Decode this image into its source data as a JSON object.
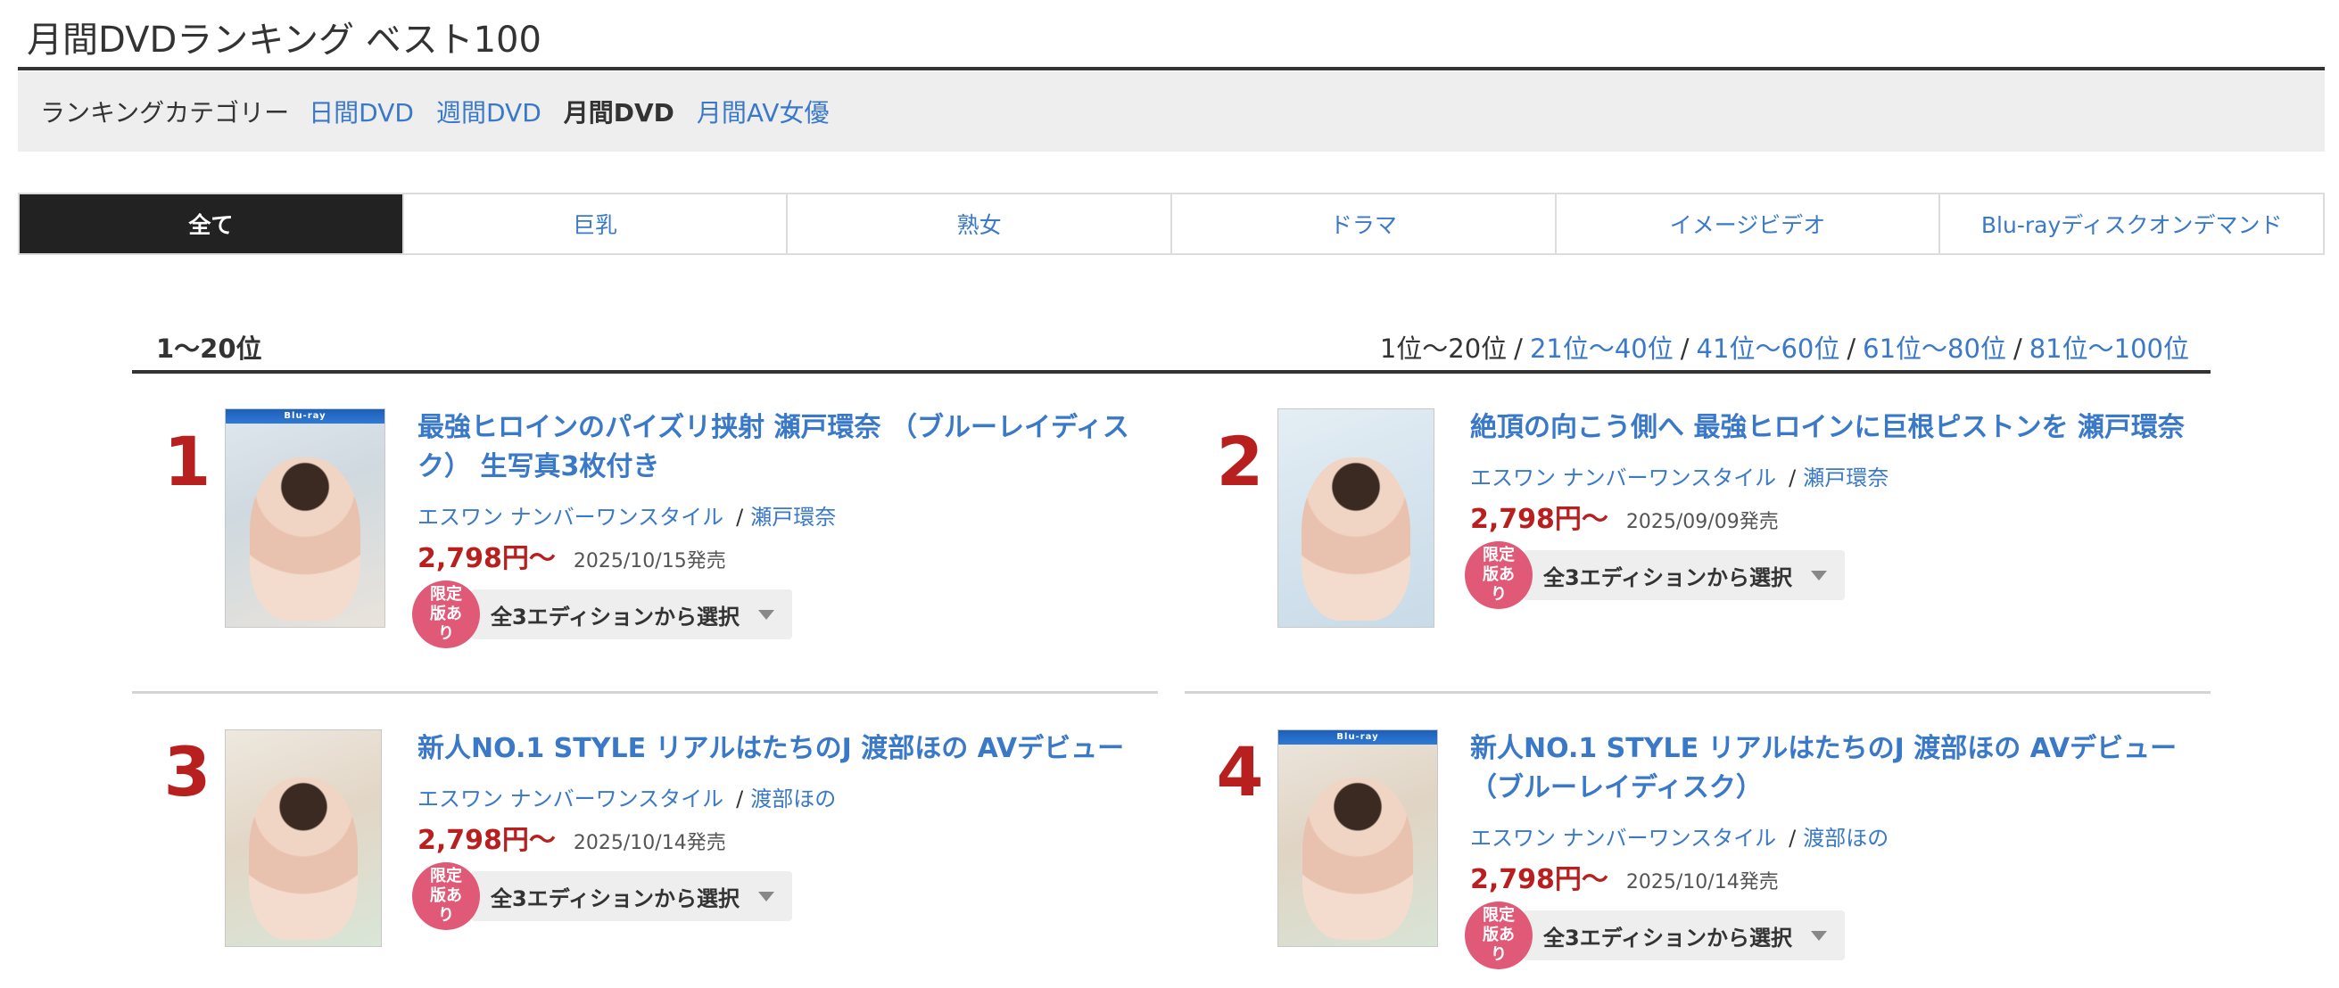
{
  "page_title": "月間DVDランキング ベスト100",
  "category_bar": {
    "label": "ランキングカテゴリー",
    "links": [
      "日間DVD",
      "週間DVD"
    ],
    "current": "月間DVD",
    "links_after": [
      "月間AV女優"
    ]
  },
  "genre_tabs": [
    "全て",
    "巨乳",
    "熟女",
    "ドラマ",
    "イメージビデオ",
    "Blu-rayディスクオンデマンド"
  ],
  "active_genre_index": 0,
  "range": {
    "current": "1〜20位",
    "pages": [
      "1位〜20位",
      "21位〜40位",
      "41位〜60位",
      "61位〜80位",
      "81位〜100位"
    ],
    "current_page_index": 0,
    "separator": "/"
  },
  "items": [
    {
      "rank": "1",
      "title": "最強ヒロインのパイズリ挟射 瀬戸環奈 （ブルーレイディスク） 生写真3枚付き",
      "maker": "エスワン ナンバーワンスタイル",
      "actress": "瀬戸環奈",
      "price": "2,798円〜",
      "release": "2025/10/15発売",
      "badge": "限定版あり",
      "edition": "全3エディションから選択",
      "bluray_band": "Blu-ray"
    },
    {
      "rank": "2",
      "title": "絶頂の向こう側へ 最強ヒロインに巨根ピストンを 瀬戸環奈",
      "maker": "エスワン ナンバーワンスタイル",
      "actress": "瀬戸環奈",
      "price": "2,798円〜",
      "release": "2025/09/09発売",
      "badge": "限定版あり",
      "edition": "全3エディションから選択"
    },
    {
      "rank": "3",
      "title": "新人NO.1 STYLE リアルはたちのJ 渡部ほの AVデビュー",
      "maker": "エスワン ナンバーワンスタイル",
      "actress": "渡部ほの",
      "price": "2,798円〜",
      "release": "2025/10/14発売",
      "badge": "限定版あり",
      "edition": "全3エディションから選択"
    },
    {
      "rank": "4",
      "title": "新人NO.1 STYLE リアルはたちのJ 渡部ほの AVデビュー （ブルーレイディスク）",
      "maker": "エスワン ナンバーワンスタイル",
      "actress": "渡部ほの",
      "price": "2,798円〜",
      "release": "2025/10/14発売",
      "badge": "限定版あり",
      "edition": "全3エディションから選択",
      "bluray_band": "Blu-ray"
    }
  ],
  "colors": {
    "link": "#3a78c8",
    "rank": "#b82020",
    "price": "#b82020",
    "badge": "#e05a78",
    "active_tab_bg": "#222222"
  }
}
